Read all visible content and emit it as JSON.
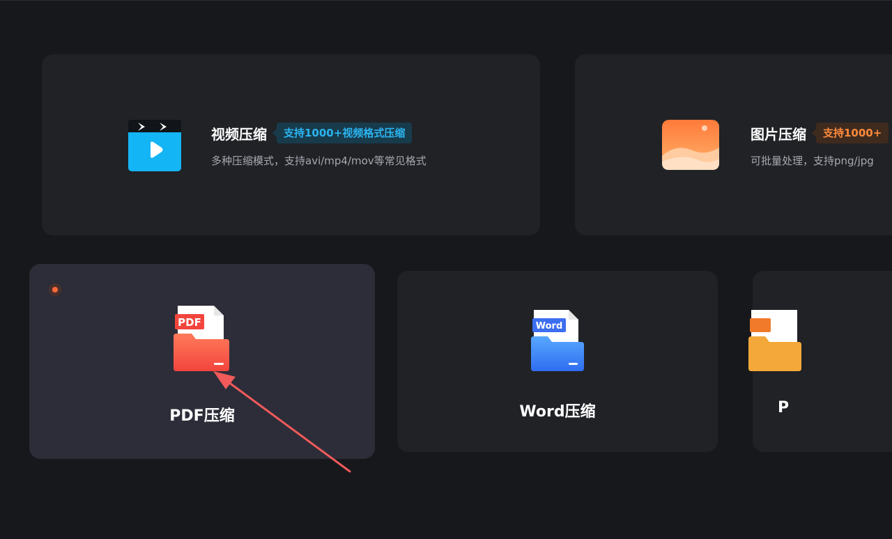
{
  "cards": {
    "video": {
      "title": "视频压缩",
      "badge": "支持1000+视频格式压缩",
      "desc": "多种压缩模式，支持avi/mp4/mov等常见格式",
      "icon": "video-clapper-icon"
    },
    "image": {
      "title": "图片压缩",
      "badge": "支持1000+",
      "desc": "可批量处理，支持png/jpg",
      "icon": "image-landscape-icon"
    },
    "pdf": {
      "label": "PDF压缩",
      "icon_text": "PDF",
      "icon": "pdf-folder-icon"
    },
    "word": {
      "label": "Word压缩",
      "icon_text": "Word",
      "icon": "word-folder-icon"
    },
    "ppt": {
      "label": "P",
      "icon": "ppt-folder-icon"
    }
  },
  "colors": {
    "background": "#16181c",
    "card": "#202226",
    "card_selected": "#2c2d38",
    "video_accent": "#2bb4f0",
    "image_accent": "#ff8a3d",
    "pdf_accent": "#ff5a4e",
    "word_accent": "#3c7cff",
    "arrow": "#f05a5a"
  }
}
